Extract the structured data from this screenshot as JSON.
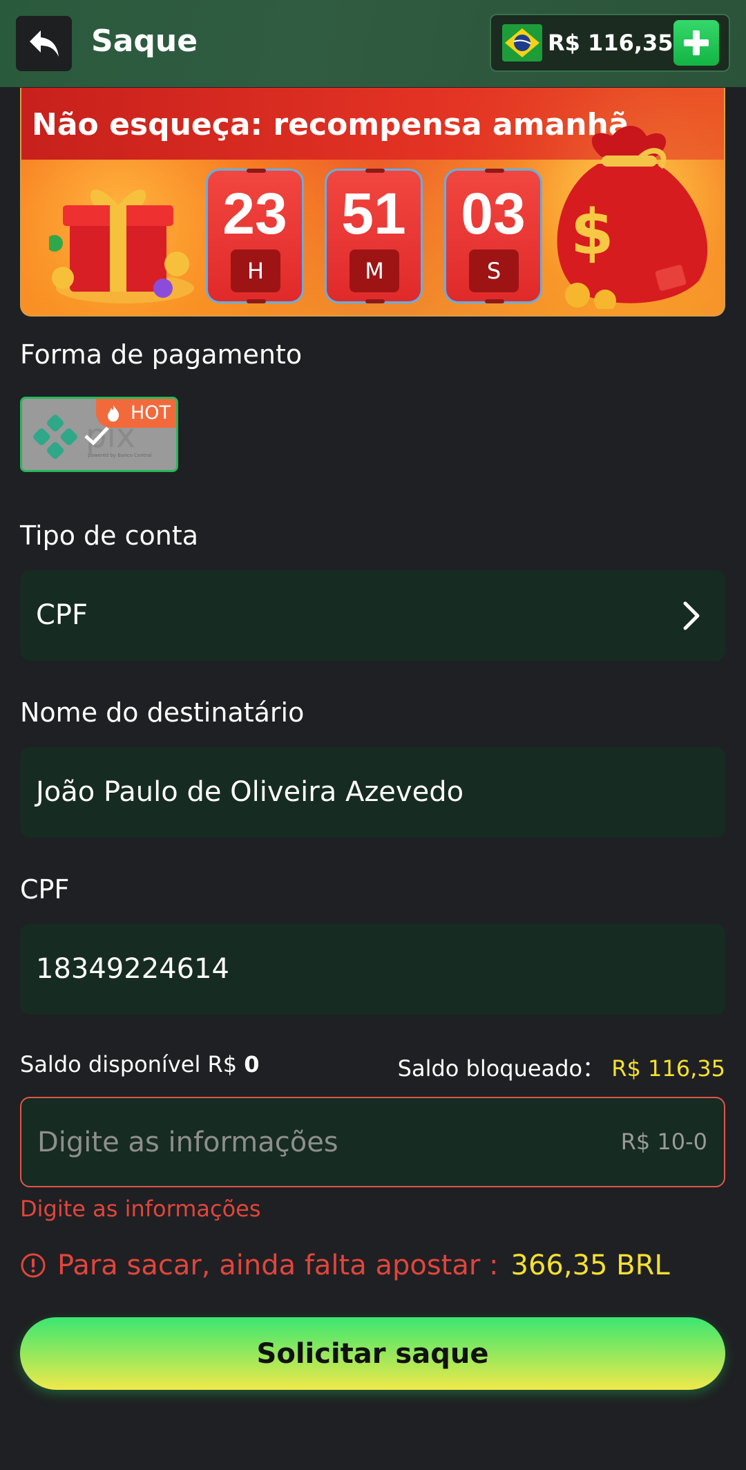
{
  "header": {
    "title": "Saque",
    "balance": "R$ 116,35"
  },
  "banner": {
    "title": "Não esqueça: recompensa amanhã",
    "timer": [
      {
        "value": "23",
        "unit": "H"
      },
      {
        "value": "51",
        "unit": "M"
      },
      {
        "value": "03",
        "unit": "S"
      }
    ]
  },
  "payment": {
    "label": "Forma de pagamento",
    "method": "pix",
    "method_caption": "powered by Banco Central",
    "badge": "HOT"
  },
  "account_type": {
    "label": "Tipo de conta",
    "value": "CPF"
  },
  "recipient": {
    "label": "Nome do destinatário",
    "value": "João Paulo de Oliveira Azevedo"
  },
  "cpf": {
    "label": "CPF",
    "value": "18349224614"
  },
  "balances": {
    "available_label": "Saldo disponível R$",
    "available_value": "0",
    "blocked_label": "Saldo bloqueado：",
    "blocked_value": "R$ 116,35"
  },
  "amount": {
    "placeholder": "Digite as informações",
    "range": "R$ 10-0",
    "error": "Digite as informações"
  },
  "warning": {
    "text": "Para sacar, ainda falta apostar :",
    "amount": "366,35 BRL"
  },
  "submit_label": "Solicitar saque",
  "colors": {
    "accent_green": "#27b85a",
    "highlight_yellow": "#f6e12d",
    "error_red": "#e2453c",
    "field_bg": "#162b22"
  },
  "icons": [
    "back-arrow-icon",
    "brazil-flag-icon",
    "plus-icon",
    "chevron-right-icon",
    "alert-circle-icon",
    "fire-icon",
    "check-icon"
  ]
}
